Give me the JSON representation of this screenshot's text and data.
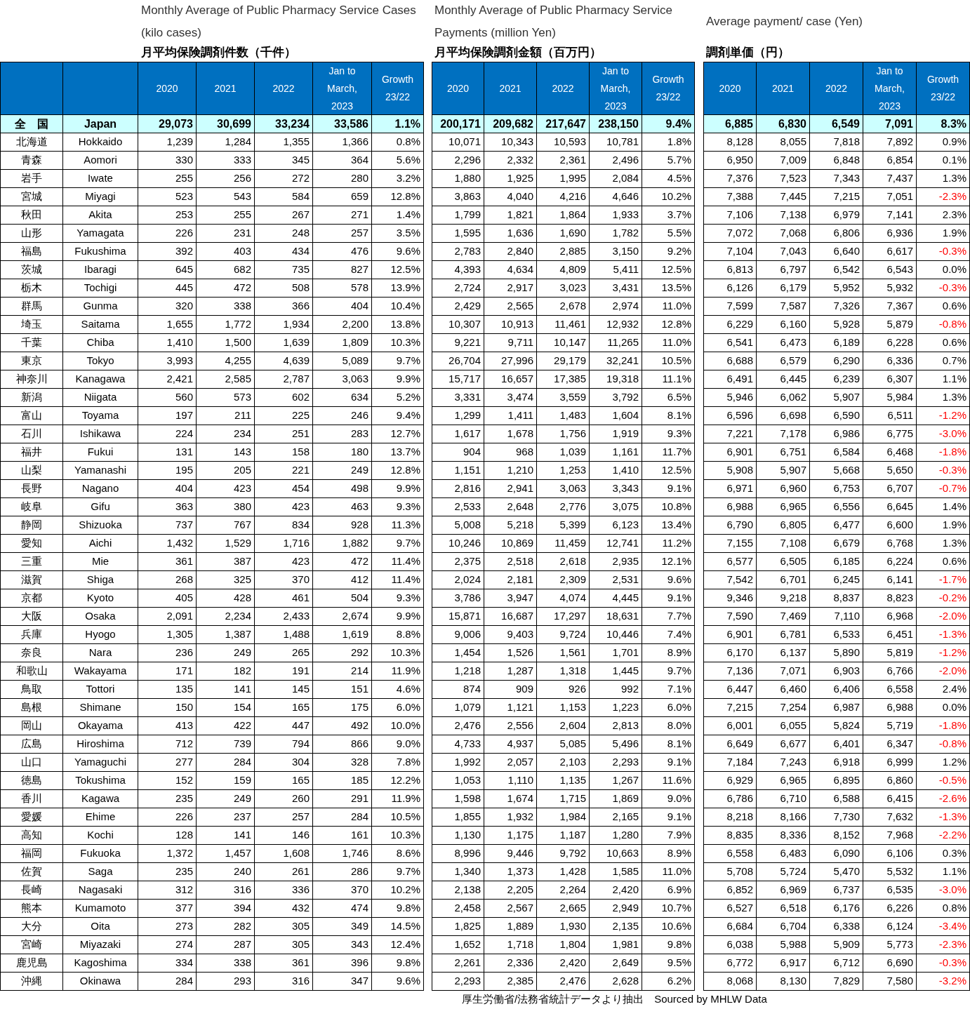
{
  "sections": [
    {
      "title_en": "Monthly Average of Public Pharmacy Service Cases (kilo cases)",
      "title_jp": "月平均保険調剤件数（千件）",
      "columns": [
        "2020",
        "2021",
        "2022",
        "Jan to March, 2023",
        "Growth 23/22"
      ]
    },
    {
      "title_en": "Monthly Average of Public Pharmacy Service Payments (million Yen)",
      "title_jp": "月平均保険調剤金額（百万円）",
      "columns": [
        "2020",
        "2021",
        "2022",
        "Jan to March, 2023",
        "Growth 23/22"
      ]
    },
    {
      "title_en": "Average payment/ case (Yen)",
      "title_jp": "調剤単価（円）",
      "columns": [
        "2020",
        "2021",
        "2022",
        "Jan to March, 2023",
        "Growth 23/22"
      ]
    }
  ],
  "total": {
    "jp": "全　国",
    "en": "Japan",
    "cases": [
      "29,073",
      "30,699",
      "33,234",
      "33,586",
      "1.1%"
    ],
    "payments": [
      "200,171",
      "209,682",
      "217,647",
      "238,150",
      "9.4%"
    ],
    "unit": [
      "6,885",
      "6,830",
      "6,549",
      "7,091",
      "8.3%"
    ],
    "unit_down": false
  },
  "rows": [
    {
      "jp": "北海道",
      "en": "Hokkaido",
      "cases": [
        "1,239",
        "1,284",
        "1,355",
        "1,366",
        "0.8%"
      ],
      "payments": [
        "10,071",
        "10,343",
        "10,593",
        "10,781",
        "1.8%"
      ],
      "unit": [
        "8,128",
        "8,055",
        "7,818",
        "7,892",
        "0.9%"
      ],
      "unit_down": false
    },
    {
      "jp": "青森",
      "en": "Aomori",
      "cases": [
        "330",
        "333",
        "345",
        "364",
        "5.6%"
      ],
      "payments": [
        "2,296",
        "2,332",
        "2,361",
        "2,496",
        "5.7%"
      ],
      "unit": [
        "6,950",
        "7,009",
        "6,848",
        "6,854",
        "0.1%"
      ],
      "unit_down": false
    },
    {
      "jp": "岩手",
      "en": "Iwate",
      "cases": [
        "255",
        "256",
        "272",
        "280",
        "3.2%"
      ],
      "payments": [
        "1,880",
        "1,925",
        "1,995",
        "2,084",
        "4.5%"
      ],
      "unit": [
        "7,376",
        "7,523",
        "7,343",
        "7,437",
        "1.3%"
      ],
      "unit_down": false
    },
    {
      "jp": "宮城",
      "en": "Miyagi",
      "cases": [
        "523",
        "543",
        "584",
        "659",
        "12.8%"
      ],
      "payments": [
        "3,863",
        "4,040",
        "4,216",
        "4,646",
        "10.2%"
      ],
      "unit": [
        "7,388",
        "7,445",
        "7,215",
        "7,051",
        "-2.3%"
      ],
      "unit_down": true
    },
    {
      "jp": "秋田",
      "en": "Akita",
      "cases": [
        "253",
        "255",
        "267",
        "271",
        "1.4%"
      ],
      "payments": [
        "1,799",
        "1,821",
        "1,864",
        "1,933",
        "3.7%"
      ],
      "unit": [
        "7,106",
        "7,138",
        "6,979",
        "7,141",
        "2.3%"
      ],
      "unit_down": false
    },
    {
      "jp": "山形",
      "en": "Yamagata",
      "cases": [
        "226",
        "231",
        "248",
        "257",
        "3.5%"
      ],
      "payments": [
        "1,595",
        "1,636",
        "1,690",
        "1,782",
        "5.5%"
      ],
      "unit": [
        "7,072",
        "7,068",
        "6,806",
        "6,936",
        "1.9%"
      ],
      "unit_down": false
    },
    {
      "jp": "福島",
      "en": "Fukushima",
      "cases": [
        "392",
        "403",
        "434",
        "476",
        "9.6%"
      ],
      "payments": [
        "2,783",
        "2,840",
        "2,885",
        "3,150",
        "9.2%"
      ],
      "unit": [
        "7,104",
        "7,043",
        "6,640",
        "6,617",
        "-0.3%"
      ],
      "unit_down": true
    },
    {
      "jp": "茨城",
      "en": "Ibaragi",
      "cases": [
        "645",
        "682",
        "735",
        "827",
        "12.5%"
      ],
      "payments": [
        "4,393",
        "4,634",
        "4,809",
        "5,411",
        "12.5%"
      ],
      "unit": [
        "6,813",
        "6,797",
        "6,542",
        "6,543",
        "0.0%"
      ],
      "unit_down": false
    },
    {
      "jp": "栃木",
      "en": "Tochigi",
      "cases": [
        "445",
        "472",
        "508",
        "578",
        "13.9%"
      ],
      "payments": [
        "2,724",
        "2,917",
        "3,023",
        "3,431",
        "13.5%"
      ],
      "unit": [
        "6,126",
        "6,179",
        "5,952",
        "5,932",
        "-0.3%"
      ],
      "unit_down": true
    },
    {
      "jp": "群馬",
      "en": "Gunma",
      "cases": [
        "320",
        "338",
        "366",
        "404",
        "10.4%"
      ],
      "payments": [
        "2,429",
        "2,565",
        "2,678",
        "2,974",
        "11.0%"
      ],
      "unit": [
        "7,599",
        "7,587",
        "7,326",
        "7,367",
        "0.6%"
      ],
      "unit_down": false
    },
    {
      "jp": "埼玉",
      "en": "Saitama",
      "cases": [
        "1,655",
        "1,772",
        "1,934",
        "2,200",
        "13.8%"
      ],
      "payments": [
        "10,307",
        "10,913",
        "11,461",
        "12,932",
        "12.8%"
      ],
      "unit": [
        "6,229",
        "6,160",
        "5,928",
        "5,879",
        "-0.8%"
      ],
      "unit_down": true
    },
    {
      "jp": "千葉",
      "en": "Chiba",
      "cases": [
        "1,410",
        "1,500",
        "1,639",
        "1,809",
        "10.3%"
      ],
      "payments": [
        "9,221",
        "9,711",
        "10,147",
        "11,265",
        "11.0%"
      ],
      "unit": [
        "6,541",
        "6,473",
        "6,189",
        "6,228",
        "0.6%"
      ],
      "unit_down": false
    },
    {
      "jp": "東京",
      "en": "Tokyo",
      "cases": [
        "3,993",
        "4,255",
        "4,639",
        "5,089",
        "9.7%"
      ],
      "payments": [
        "26,704",
        "27,996",
        "29,179",
        "32,241",
        "10.5%"
      ],
      "unit": [
        "6,688",
        "6,579",
        "6,290",
        "6,336",
        "0.7%"
      ],
      "unit_down": false
    },
    {
      "jp": "神奈川",
      "en": "Kanagawa",
      "cases": [
        "2,421",
        "2,585",
        "2,787",
        "3,063",
        "9.9%"
      ],
      "payments": [
        "15,717",
        "16,657",
        "17,385",
        "19,318",
        "11.1%"
      ],
      "unit": [
        "6,491",
        "6,445",
        "6,239",
        "6,307",
        "1.1%"
      ],
      "unit_down": false
    },
    {
      "jp": "新潟",
      "en": "Niigata",
      "cases": [
        "560",
        "573",
        "602",
        "634",
        "5.2%"
      ],
      "payments": [
        "3,331",
        "3,474",
        "3,559",
        "3,792",
        "6.5%"
      ],
      "unit": [
        "5,946",
        "6,062",
        "5,907",
        "5,984",
        "1.3%"
      ],
      "unit_down": false
    },
    {
      "jp": "富山",
      "en": "Toyama",
      "cases": [
        "197",
        "211",
        "225",
        "246",
        "9.4%"
      ],
      "payments": [
        "1,299",
        "1,411",
        "1,483",
        "1,604",
        "8.1%"
      ],
      "unit": [
        "6,596",
        "6,698",
        "6,590",
        "6,511",
        "-1.2%"
      ],
      "unit_down": true
    },
    {
      "jp": "石川",
      "en": "Ishikawa",
      "cases": [
        "224",
        "234",
        "251",
        "283",
        "12.7%"
      ],
      "payments": [
        "1,617",
        "1,678",
        "1,756",
        "1,919",
        "9.3%"
      ],
      "unit": [
        "7,221",
        "7,178",
        "6,986",
        "6,775",
        "-3.0%"
      ],
      "unit_down": true
    },
    {
      "jp": "福井",
      "en": "Fukui",
      "cases": [
        "131",
        "143",
        "158",
        "180",
        "13.7%"
      ],
      "payments": [
        "904",
        "968",
        "1,039",
        "1,161",
        "11.7%"
      ],
      "unit": [
        "6,901",
        "6,751",
        "6,584",
        "6,468",
        "-1.8%"
      ],
      "unit_down": true
    },
    {
      "jp": "山梨",
      "en": "Yamanashi",
      "cases": [
        "195",
        "205",
        "221",
        "249",
        "12.8%"
      ],
      "payments": [
        "1,151",
        "1,210",
        "1,253",
        "1,410",
        "12.5%"
      ],
      "unit": [
        "5,908",
        "5,907",
        "5,668",
        "5,650",
        "-0.3%"
      ],
      "unit_down": true
    },
    {
      "jp": "長野",
      "en": "Nagano",
      "cases": [
        "404",
        "423",
        "454",
        "498",
        "9.9%"
      ],
      "payments": [
        "2,816",
        "2,941",
        "3,063",
        "3,343",
        "9.1%"
      ],
      "unit": [
        "6,971",
        "6,960",
        "6,753",
        "6,707",
        "-0.7%"
      ],
      "unit_down": true
    },
    {
      "jp": "岐阜",
      "en": "Gifu",
      "cases": [
        "363",
        "380",
        "423",
        "463",
        "9.3%"
      ],
      "payments": [
        "2,533",
        "2,648",
        "2,776",
        "3,075",
        "10.8%"
      ],
      "unit": [
        "6,988",
        "6,965",
        "6,556",
        "6,645",
        "1.4%"
      ],
      "unit_down": false
    },
    {
      "jp": "静岡",
      "en": "Shizuoka",
      "cases": [
        "737",
        "767",
        "834",
        "928",
        "11.3%"
      ],
      "payments": [
        "5,008",
        "5,218",
        "5,399",
        "6,123",
        "13.4%"
      ],
      "unit": [
        "6,790",
        "6,805",
        "6,477",
        "6,600",
        "1.9%"
      ],
      "unit_down": false
    },
    {
      "jp": "愛知",
      "en": "Aichi",
      "cases": [
        "1,432",
        "1,529",
        "1,716",
        "1,882",
        "9.7%"
      ],
      "payments": [
        "10,246",
        "10,869",
        "11,459",
        "12,741",
        "11.2%"
      ],
      "unit": [
        "7,155",
        "7,108",
        "6,679",
        "6,768",
        "1.3%"
      ],
      "unit_down": false
    },
    {
      "jp": "三重",
      "en": "Mie",
      "cases": [
        "361",
        "387",
        "423",
        "472",
        "11.4%"
      ],
      "payments": [
        "2,375",
        "2,518",
        "2,618",
        "2,935",
        "12.1%"
      ],
      "unit": [
        "6,577",
        "6,505",
        "6,185",
        "6,224",
        "0.6%"
      ],
      "unit_down": false
    },
    {
      "jp": "滋賀",
      "en": "Shiga",
      "cases": [
        "268",
        "325",
        "370",
        "412",
        "11.4%"
      ],
      "payments": [
        "2,024",
        "2,181",
        "2,309",
        "2,531",
        "9.6%"
      ],
      "unit": [
        "7,542",
        "6,701",
        "6,245",
        "6,141",
        "-1.7%"
      ],
      "unit_down": true
    },
    {
      "jp": "京都",
      "en": "Kyoto",
      "cases": [
        "405",
        "428",
        "461",
        "504",
        "9.3%"
      ],
      "payments": [
        "3,786",
        "3,947",
        "4,074",
        "4,445",
        "9.1%"
      ],
      "unit": [
        "9,346",
        "9,218",
        "8,837",
        "8,823",
        "-0.2%"
      ],
      "unit_down": true
    },
    {
      "jp": "大阪",
      "en": "Osaka",
      "cases": [
        "2,091",
        "2,234",
        "2,433",
        "2,674",
        "9.9%"
      ],
      "payments": [
        "15,871",
        "16,687",
        "17,297",
        "18,631",
        "7.7%"
      ],
      "unit": [
        "7,590",
        "7,469",
        "7,110",
        "6,968",
        "-2.0%"
      ],
      "unit_down": true
    },
    {
      "jp": "兵庫",
      "en": "Hyogo",
      "cases": [
        "1,305",
        "1,387",
        "1,488",
        "1,619",
        "8.8%"
      ],
      "payments": [
        "9,006",
        "9,403",
        "9,724",
        "10,446",
        "7.4%"
      ],
      "unit": [
        "6,901",
        "6,781",
        "6,533",
        "6,451",
        "-1.3%"
      ],
      "unit_down": true
    },
    {
      "jp": "奈良",
      "en": "Nara",
      "cases": [
        "236",
        "249",
        "265",
        "292",
        "10.3%"
      ],
      "payments": [
        "1,454",
        "1,526",
        "1,561",
        "1,701",
        "8.9%"
      ],
      "unit": [
        "6,170",
        "6,137",
        "5,890",
        "5,819",
        "-1.2%"
      ],
      "unit_down": true
    },
    {
      "jp": "和歌山",
      "en": "Wakayama",
      "cases": [
        "171",
        "182",
        "191",
        "214",
        "11.9%"
      ],
      "payments": [
        "1,218",
        "1,287",
        "1,318",
        "1,445",
        "9.7%"
      ],
      "unit": [
        "7,136",
        "7,071",
        "6,903",
        "6,766",
        "-2.0%"
      ],
      "unit_down": true
    },
    {
      "jp": "鳥取",
      "en": "Tottori",
      "cases": [
        "135",
        "141",
        "145",
        "151",
        "4.6%"
      ],
      "payments": [
        "874",
        "909",
        "926",
        "992",
        "7.1%"
      ],
      "unit": [
        "6,447",
        "6,460",
        "6,406",
        "6,558",
        "2.4%"
      ],
      "unit_down": false
    },
    {
      "jp": "島根",
      "en": "Shimane",
      "cases": [
        "150",
        "154",
        "165",
        "175",
        "6.0%"
      ],
      "payments": [
        "1,079",
        "1,121",
        "1,153",
        "1,223",
        "6.0%"
      ],
      "unit": [
        "7,215",
        "7,254",
        "6,987",
        "6,988",
        "0.0%"
      ],
      "unit_down": false
    },
    {
      "jp": "岡山",
      "en": "Okayama",
      "cases": [
        "413",
        "422",
        "447",
        "492",
        "10.0%"
      ],
      "payments": [
        "2,476",
        "2,556",
        "2,604",
        "2,813",
        "8.0%"
      ],
      "unit": [
        "6,001",
        "6,055",
        "5,824",
        "5,719",
        "-1.8%"
      ],
      "unit_down": true
    },
    {
      "jp": "広島",
      "en": "Hiroshima",
      "cases": [
        "712",
        "739",
        "794",
        "866",
        "9.0%"
      ],
      "payments": [
        "4,733",
        "4,937",
        "5,085",
        "5,496",
        "8.1%"
      ],
      "unit": [
        "6,649",
        "6,677",
        "6,401",
        "6,347",
        "-0.8%"
      ],
      "unit_down": true
    },
    {
      "jp": "山口",
      "en": "Yamaguchi",
      "cases": [
        "277",
        "284",
        "304",
        "328",
        "7.8%"
      ],
      "payments": [
        "1,992",
        "2,057",
        "2,103",
        "2,293",
        "9.1%"
      ],
      "unit": [
        "7,184",
        "7,243",
        "6,918",
        "6,999",
        "1.2%"
      ],
      "unit_down": false
    },
    {
      "jp": "徳島",
      "en": "Tokushima",
      "cases": [
        "152",
        "159",
        "165",
        "185",
        "12.2%"
      ],
      "payments": [
        "1,053",
        "1,110",
        "1,135",
        "1,267",
        "11.6%"
      ],
      "unit": [
        "6,929",
        "6,965",
        "6,895",
        "6,860",
        "-0.5%"
      ],
      "unit_down": true
    },
    {
      "jp": "香川",
      "en": "Kagawa",
      "cases": [
        "235",
        "249",
        "260",
        "291",
        "11.9%"
      ],
      "payments": [
        "1,598",
        "1,674",
        "1,715",
        "1,869",
        "9.0%"
      ],
      "unit": [
        "6,786",
        "6,710",
        "6,588",
        "6,415",
        "-2.6%"
      ],
      "unit_down": true
    },
    {
      "jp": "愛媛",
      "en": "Ehime",
      "cases": [
        "226",
        "237",
        "257",
        "284",
        "10.5%"
      ],
      "payments": [
        "1,855",
        "1,932",
        "1,984",
        "2,165",
        "9.1%"
      ],
      "unit": [
        "8,218",
        "8,166",
        "7,730",
        "7,632",
        "-1.3%"
      ],
      "unit_down": true
    },
    {
      "jp": "高知",
      "en": "Kochi",
      "cases": [
        "128",
        "141",
        "146",
        "161",
        "10.3%"
      ],
      "payments": [
        "1,130",
        "1,175",
        "1,187",
        "1,280",
        "7.9%"
      ],
      "unit": [
        "8,835",
        "8,336",
        "8,152",
        "7,968",
        "-2.2%"
      ],
      "unit_down": true
    },
    {
      "jp": "福岡",
      "en": "Fukuoka",
      "cases": [
        "1,372",
        "1,457",
        "1,608",
        "1,746",
        "8.6%"
      ],
      "payments": [
        "8,996",
        "9,446",
        "9,792",
        "10,663",
        "8.9%"
      ],
      "unit": [
        "6,558",
        "6,483",
        "6,090",
        "6,106",
        "0.3%"
      ],
      "unit_down": false
    },
    {
      "jp": "佐賀",
      "en": "Saga",
      "cases": [
        "235",
        "240",
        "261",
        "286",
        "9.7%"
      ],
      "payments": [
        "1,340",
        "1,373",
        "1,428",
        "1,585",
        "11.0%"
      ],
      "unit": [
        "5,708",
        "5,724",
        "5,470",
        "5,532",
        "1.1%"
      ],
      "unit_down": false
    },
    {
      "jp": "長崎",
      "en": "Nagasaki",
      "cases": [
        "312",
        "316",
        "336",
        "370",
        "10.2%"
      ],
      "payments": [
        "2,138",
        "2,205",
        "2,264",
        "2,420",
        "6.9%"
      ],
      "unit": [
        "6,852",
        "6,969",
        "6,737",
        "6,535",
        "-3.0%"
      ],
      "unit_down": true
    },
    {
      "jp": "熊本",
      "en": "Kumamoto",
      "cases": [
        "377",
        "394",
        "432",
        "474",
        "9.8%"
      ],
      "payments": [
        "2,458",
        "2,567",
        "2,665",
        "2,949",
        "10.7%"
      ],
      "unit": [
        "6,527",
        "6,518",
        "6,176",
        "6,226",
        "0.8%"
      ],
      "unit_down": false
    },
    {
      "jp": "大分",
      "en": "Oita",
      "cases": [
        "273",
        "282",
        "305",
        "349",
        "14.5%"
      ],
      "payments": [
        "1,825",
        "1,889",
        "1,930",
        "2,135",
        "10.6%"
      ],
      "unit": [
        "6,684",
        "6,704",
        "6,338",
        "6,124",
        "-3.4%"
      ],
      "unit_down": true
    },
    {
      "jp": "宮崎",
      "en": "Miyazaki",
      "cases": [
        "274",
        "287",
        "305",
        "343",
        "12.4%"
      ],
      "payments": [
        "1,652",
        "1,718",
        "1,804",
        "1,981",
        "9.8%"
      ],
      "unit": [
        "6,038",
        "5,988",
        "5,909",
        "5,773",
        "-2.3%"
      ],
      "unit_down": true
    },
    {
      "jp": "鹿児島",
      "en": "Kagoshima",
      "cases": [
        "334",
        "338",
        "361",
        "396",
        "9.8%"
      ],
      "payments": [
        "2,261",
        "2,336",
        "2,420",
        "2,649",
        "9.5%"
      ],
      "unit": [
        "6,772",
        "6,917",
        "6,712",
        "6,690",
        "-0.3%"
      ],
      "unit_down": true
    },
    {
      "jp": "沖縄",
      "en": "Okinawa",
      "cases": [
        "284",
        "293",
        "316",
        "347",
        "9.6%"
      ],
      "payments": [
        "2,293",
        "2,385",
        "2,476",
        "2,628",
        "6.2%"
      ],
      "unit": [
        "8,068",
        "8,130",
        "7,829",
        "7,580",
        "-3.2%"
      ],
      "unit_down": true
    }
  ],
  "source_note": "厚生労働省/法務省統計データより抽出　Sourced by MHLW Data"
}
